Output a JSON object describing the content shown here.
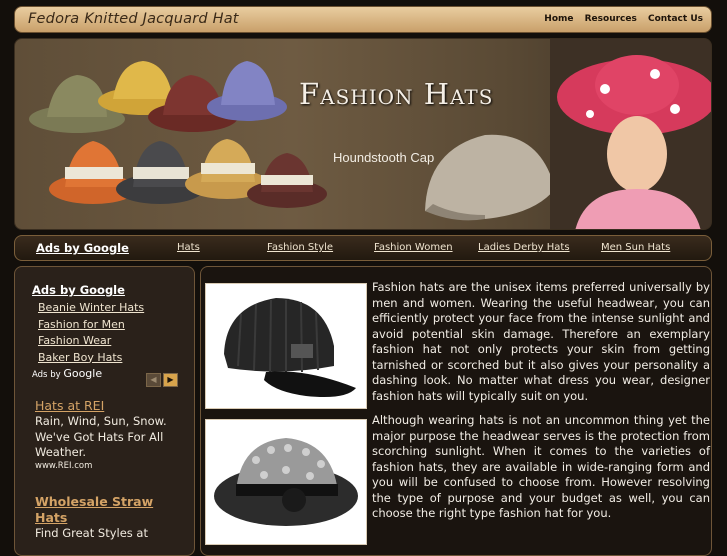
{
  "header": {
    "site_title": "Fedora Knitted Jacquard Hat",
    "nav": [
      "Home",
      "Resources",
      "Contact Us"
    ]
  },
  "banner": {
    "title": "Fashion Hats",
    "caption": "Houndstooth Cap"
  },
  "adbar": {
    "label": "Ads by Google",
    "links": [
      "Hats",
      "Fashion Style",
      "Fashion Women",
      "Ladies Derby Hats",
      "Men Sun Hats"
    ]
  },
  "sidebar": {
    "ads_heading": "Ads by Google",
    "links": [
      "Beanie Winter Hats",
      "Fashion for Men",
      "Fashion Wear",
      "Baker Boy Hats"
    ],
    "google_ads_label": "Ads by",
    "google_word": "Google",
    "ads": [
      {
        "title": "Hats at REI",
        "description": "Rain, Wind, Sun, Snow. We've Got Hats For All Weather.",
        "url": "www.REI.com"
      },
      {
        "title": "Wholesale Straw Hats",
        "description": "Find Great Styles at"
      }
    ]
  },
  "article": {
    "paragraphs": [
      "Fashion hats are the unisex items preferred universally by men and women. Wearing the useful headwear, you can efficiently protect your face from the intense sunlight and avoid potential skin damage. Therefore an exemplary fashion hat not only protects your skin from getting tarnished or scorched but it also gives your personality a dashing look. No matter what dress you wear, designer fashion hats will typically suit on you.",
      "Although wearing hats is not an uncommon thing yet the major purpose the headwear serves is the protection from scorching sunlight. When it comes to the varieties of fashion hats, they are available in wide-ranging form and you will be confused to choose from. However resolving the type of purpose and your budget as well, you can choose the right type fashion hat for you."
    ]
  },
  "colors": {
    "background": "#130f0b",
    "header_bar": "#d8b482",
    "sidebar_ad_title": "#d4a366"
  }
}
